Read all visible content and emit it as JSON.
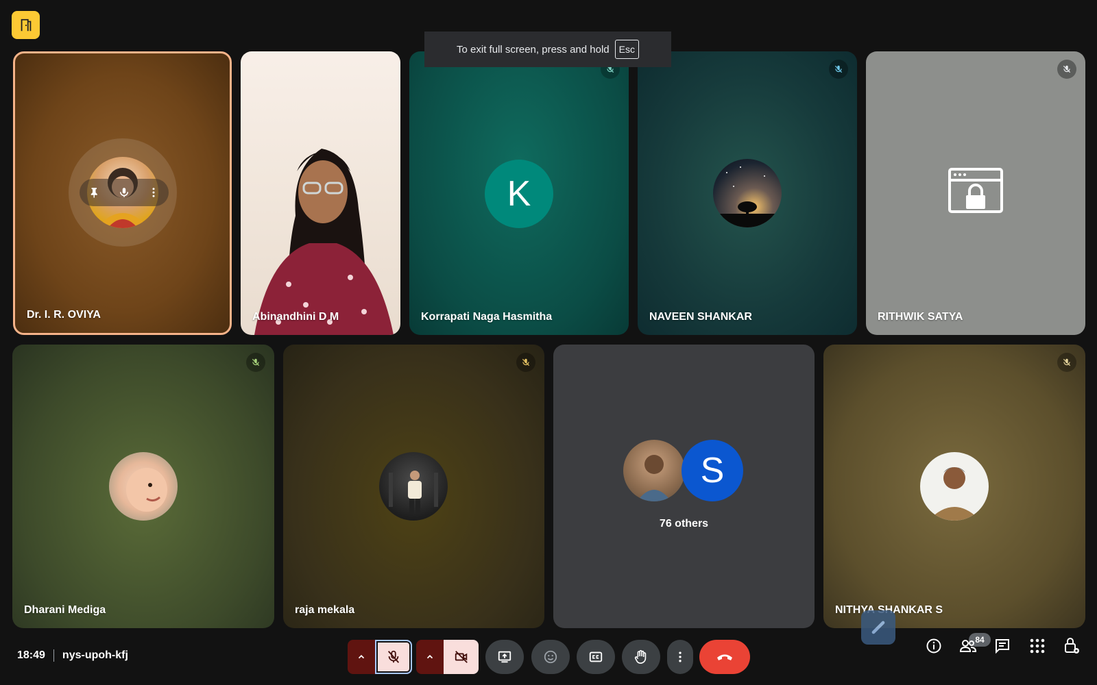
{
  "toast": {
    "text": "To exit full screen, press and hold",
    "key": "Esc"
  },
  "participants": [
    {
      "name": "Dr. I. R. OVIYA",
      "type": "photo-avatar",
      "speaking": true
    },
    {
      "name": "Abinandhini D M",
      "type": "video"
    },
    {
      "name": "Korrapati Naga Hasmitha",
      "type": "letter-avatar",
      "letter": "K",
      "avatar_color": "#00897b",
      "muted": true
    },
    {
      "name": "NAVEEN SHANKAR",
      "type": "photo-avatar",
      "muted": true
    },
    {
      "name": "RITHWIK SATYA",
      "type": "locked-browser-icon",
      "muted": true
    },
    {
      "name": "Dharani Mediga",
      "type": "photo-avatar",
      "muted": true
    },
    {
      "name": "raja mekala",
      "type": "photo-avatar",
      "muted": true
    },
    {
      "name": "NITHYA SHANKAR S",
      "type": "photo-avatar",
      "muted": true
    }
  ],
  "others_tile": {
    "label": "76 others",
    "letter": "S",
    "letter_color": "#0b57d0"
  },
  "meeting": {
    "time": "18:49",
    "code": "nys-upoh-kfj"
  },
  "controls": {
    "mic": "mic-off-icon",
    "camera": "camera-off-icon",
    "present": "present-screen-icon",
    "emoji": "emoji-icon",
    "captions": "captions-icon",
    "raise_hand": "raise-hand-icon",
    "more": "more-options-icon",
    "leave": "leave-call-icon"
  },
  "right_panel": {
    "people_count": "84"
  },
  "colors": {
    "accent_speaking": "#f6b389",
    "leave_red": "#ea4335",
    "control_dark": "#3c4043"
  }
}
